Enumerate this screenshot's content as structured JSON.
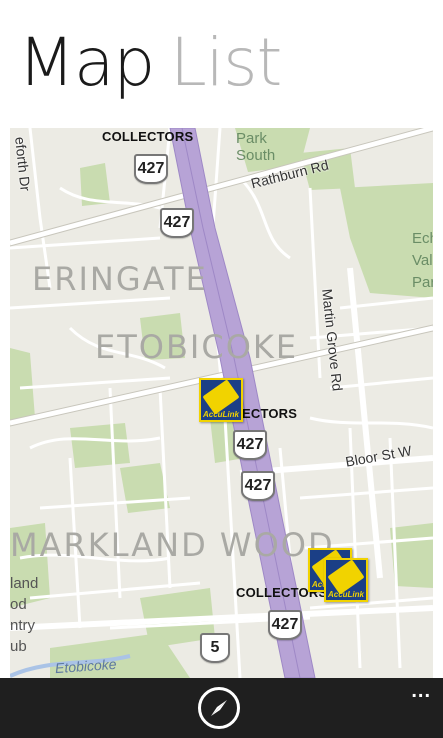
{
  "pivot": {
    "tabs": [
      {
        "label": "Map",
        "active": true
      },
      {
        "label": "List",
        "active": false
      }
    ]
  },
  "map": {
    "highway_shields": [
      "427",
      "427",
      "427",
      "427",
      "427",
      "5"
    ],
    "collector_labels": [
      "COLLECTORS",
      "ECTORS",
      "COLLECTORS"
    ],
    "road_labels": {
      "rathburn": "Rathburn Rd",
      "martin_grove": "Martin Grove Rd",
      "bloor": "Bloor St W",
      "renforth": "eforth Dr"
    },
    "area_labels": {
      "eringate": "ERINGATE",
      "etobicoke": "ETOBICOKE",
      "markland_wood": "MARKLAND WOOD"
    },
    "park_labels": {
      "park_south": "Park\nSouth",
      "valley": "Ech\nVall\nPar",
      "country_club": "land\nod\nntry\nub"
    },
    "water_label": "Etobicoke",
    "atm_pin_label": "AccuLink",
    "colors": {
      "highway": "#b7a3d6",
      "park": "#c9dcb0",
      "road": "#ffffff",
      "background": "#ecebe4",
      "water": "#aac3e6"
    }
  },
  "app_bar": {
    "primary_icon": "locate-me-icon",
    "more_label": "..."
  }
}
